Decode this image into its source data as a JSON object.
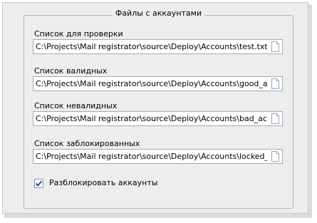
{
  "group": {
    "title": "Файлы с аккаунтами"
  },
  "fields": [
    {
      "label": "Список для проверки",
      "value": "C:\\Projects\\Mail registrator\\source\\Deploy\\Accounts\\test.txt"
    },
    {
      "label": "Список валидных",
      "value": "C:\\Projects\\Mail registrator\\source\\Deploy\\Accounts\\good_accounts"
    },
    {
      "label": "Список невалидных",
      "value": "C:\\Projects\\Mail registrator\\source\\Deploy\\Accounts\\bad_accounts."
    },
    {
      "label": "Список заблокированных",
      "value": "C:\\Projects\\Mail registrator\\source\\Deploy\\Accounts\\locked_account"
    }
  ],
  "unlock_checkbox": {
    "label": "Разблокировать аккаунты",
    "checked": true
  },
  "icons": {
    "browse": "file-icon",
    "check": "checkmark-icon"
  },
  "colors": {
    "panel": "#ededed",
    "check": "#2a4c9c"
  }
}
